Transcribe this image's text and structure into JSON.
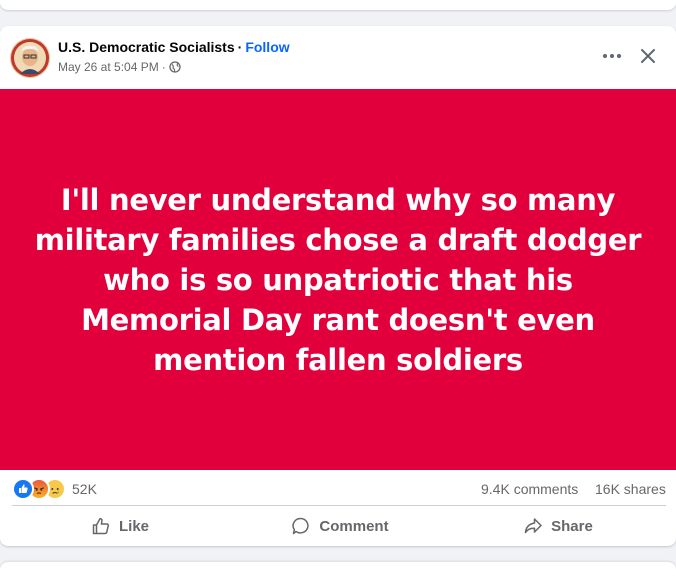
{
  "post": {
    "page_name": "U.S. Democratic Socialists",
    "separator": "·",
    "follow_label": "Follow",
    "timestamp": "May 26 at 5:04 PM",
    "audience_separator": "·",
    "audience_icon": "globe-icon",
    "background_color": "#e1003c",
    "text": "I'll never understand why so many military families chose a draft dodger who is so unpatriotic that his Memorial Day rant doesn't even mention fallen soldiers"
  },
  "engagement": {
    "reaction_icons": [
      "like-icon",
      "angry-icon",
      "sad-icon"
    ],
    "reaction_count": "52K",
    "comments": "9.4K comments",
    "shares": "16K shares"
  },
  "actions": {
    "like": "Like",
    "comment": "Comment",
    "share": "Share"
  },
  "colors": {
    "accent": "#0866ff",
    "secondary_text": "#65676b"
  }
}
